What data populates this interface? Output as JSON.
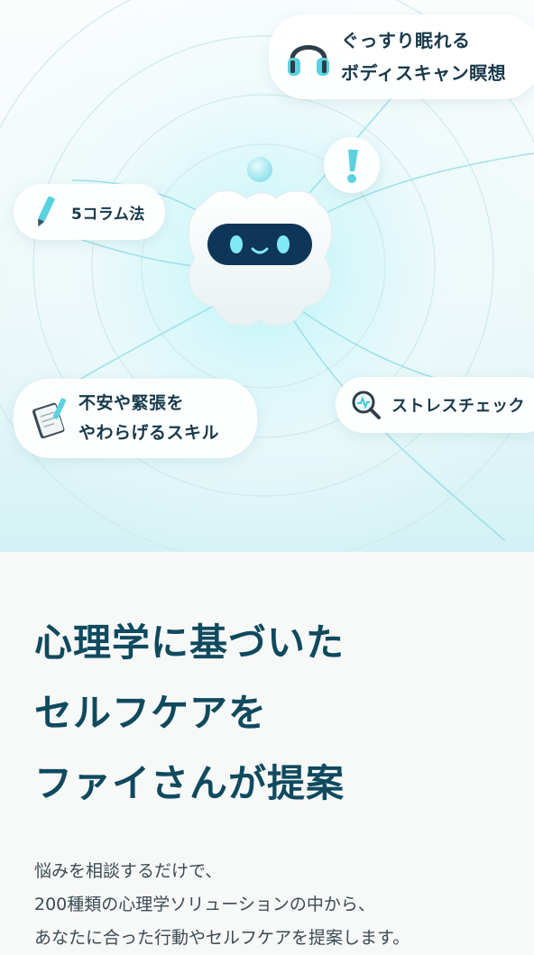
{
  "hero": {
    "chips": {
      "body_scan": {
        "line1": "ぐっすり眠れる",
        "line2": "ボディスキャン瞑想",
        "icon": "headphones-icon"
      },
      "five_column": {
        "label": "5コラム法",
        "icon": "pencil-icon"
      },
      "anxiety_skill": {
        "line1": "不安や緊張を",
        "line2": "やわらげるスキル",
        "icon": "notebook-icon"
      },
      "stress_check": {
        "label": "ストレスチェック",
        "icon": "magnifier-icon"
      },
      "alert": {
        "icon": "exclamation-icon"
      }
    },
    "mascot": {
      "icon": "robot-mascot-icon"
    },
    "colors": {
      "accent": "#3fc7d6",
      "heading": "#0f4a5e",
      "text": "#3b4b52"
    }
  },
  "main": {
    "headline": {
      "line1": "心理学に基づいた",
      "line2": "セルフケアを",
      "line3": "ファイさんが提案"
    },
    "description": {
      "line1": "悩みを相談するだけで、",
      "line2": "200種類の心理学ソリューションの中から、",
      "line3": "あなたに合った行動やセルフケアを提案します。"
    }
  }
}
